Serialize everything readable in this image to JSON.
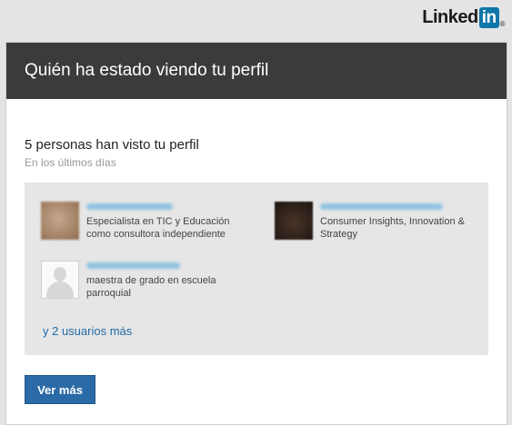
{
  "logo": {
    "text": "Linked",
    "badge": "in",
    "reg": "®",
    "accent": "#0e76a8"
  },
  "header": {
    "title": "Quién ha estado viendo tu perfil",
    "background": "#3b3b3b"
  },
  "summary": {
    "title": "5 personas han visto tu perfil",
    "caption": "En los últimos días"
  },
  "viewers": [
    {
      "headline_line1": "Especialista en TIC y Educación",
      "headline_line2": "como consultora independiente",
      "avatar": "photo-blurred"
    },
    {
      "headline_line1": "Consumer Insights, Innovation &",
      "headline_line2": "Strategy",
      "avatar": "photo-blurred"
    },
    {
      "headline_line1": "maestra de grado en escuela",
      "headline_line2": "parroquial",
      "avatar": "generic-user-icon"
    }
  ],
  "more_users_link": "y 2 usuarios más",
  "cta": {
    "label": "Ver más",
    "color": "#2a6aa6"
  }
}
